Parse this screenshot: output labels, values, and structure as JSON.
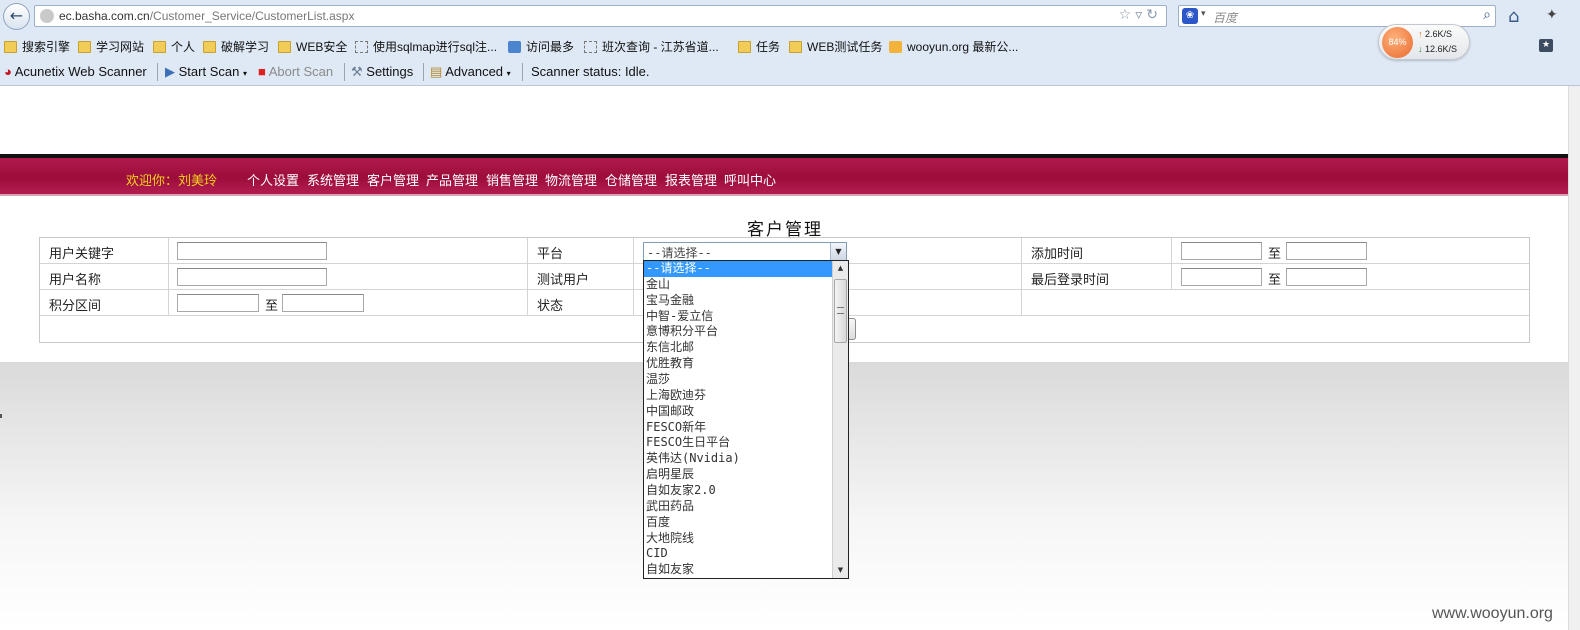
{
  "browser": {
    "url_prefix": "ec.basha.com.cn",
    "url_path": "/Customer_Service/CustomerList.aspx",
    "search_placeholder": "百度",
    "bookmarks": [
      "搜索引擎",
      "学习网站",
      "个人",
      "破解学习",
      "WEB安全",
      "使用sqlmap进行sql注...",
      "访问最多",
      "班次查询 - 江苏省道...",
      "任务",
      "WEB测试任务",
      "wooyun.org 最新公..."
    ],
    "net_widget": {
      "cpu": "84%",
      "up": "2.6K/S",
      "down": "12.6K/S"
    },
    "acunetix": {
      "name": "Acunetix Web Scanner",
      "start_scan": "Start Scan",
      "abort_scan": "Abort Scan",
      "settings": "Settings",
      "advanced": "Advanced",
      "status": "Scanner status: Idle."
    }
  },
  "app": {
    "welcome": "欢迎你：刘美玲",
    "menu": [
      "个人设置",
      "系统管理",
      "客户管理",
      "产品管理",
      "销售管理",
      "物流管理",
      "仓储管理",
      "报表管理",
      "呼叫中心"
    ],
    "page_title": "客户管理",
    "form": {
      "keyword_label": "用户关键字",
      "username_label": "用户名称",
      "points_label": "积分区间",
      "platform_label": "平台",
      "test_user_label": "测试用户",
      "status_label": "状态",
      "add_time_label": "添加时间",
      "last_login_label": "最后登录时间",
      "to": "至",
      "platform_selected": "--请选择--"
    },
    "platform_options": [
      "--请选择--",
      "金山",
      "宝马金融",
      "中智-爱立信",
      "意博积分平台",
      "东信北邮",
      "优胜教育",
      "温莎",
      "上海欧迪芬",
      "中国邮政",
      "FESCO新年",
      "FESCO生日平台",
      "英伟达(Nvidia)",
      "启明星辰",
      "自如友家2.0",
      "武田药品",
      "百度",
      "大地院线",
      "CID",
      "自如友家"
    ]
  },
  "watermark": "www.wooyun.org",
  "colors": {
    "nav_bar": "#9c0d3b",
    "welcome": "#f4d21b",
    "dropdown_highlight": "#3399ff"
  }
}
